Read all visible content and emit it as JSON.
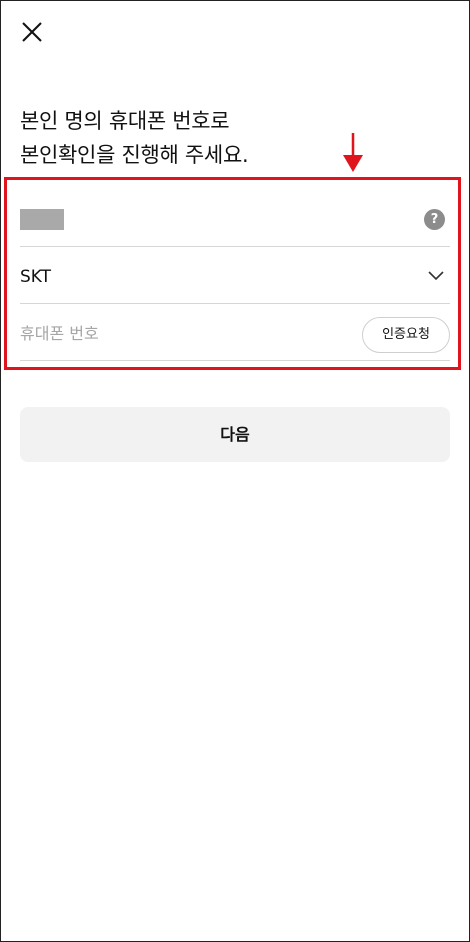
{
  "header": {
    "close_icon": "close-icon"
  },
  "headline": {
    "line1": "본인 명의 휴대폰 번호로",
    "line2": "본인확인을 진행해 주세요."
  },
  "form": {
    "name_field": {
      "help_icon_glyph": "?"
    },
    "carrier": {
      "selected": "SKT",
      "icon": "chevron-down-icon"
    },
    "phone": {
      "placeholder": "휴대폰 번호",
      "value": "",
      "verify_button_label": "인증요청"
    }
  },
  "footer": {
    "next_label": "다음"
  },
  "colors": {
    "annotation_red": "#e0141c",
    "divider": "#d6d6d6",
    "next_button_bg": "#f2f2f2",
    "help_icon_bg": "#8c8c8c"
  }
}
